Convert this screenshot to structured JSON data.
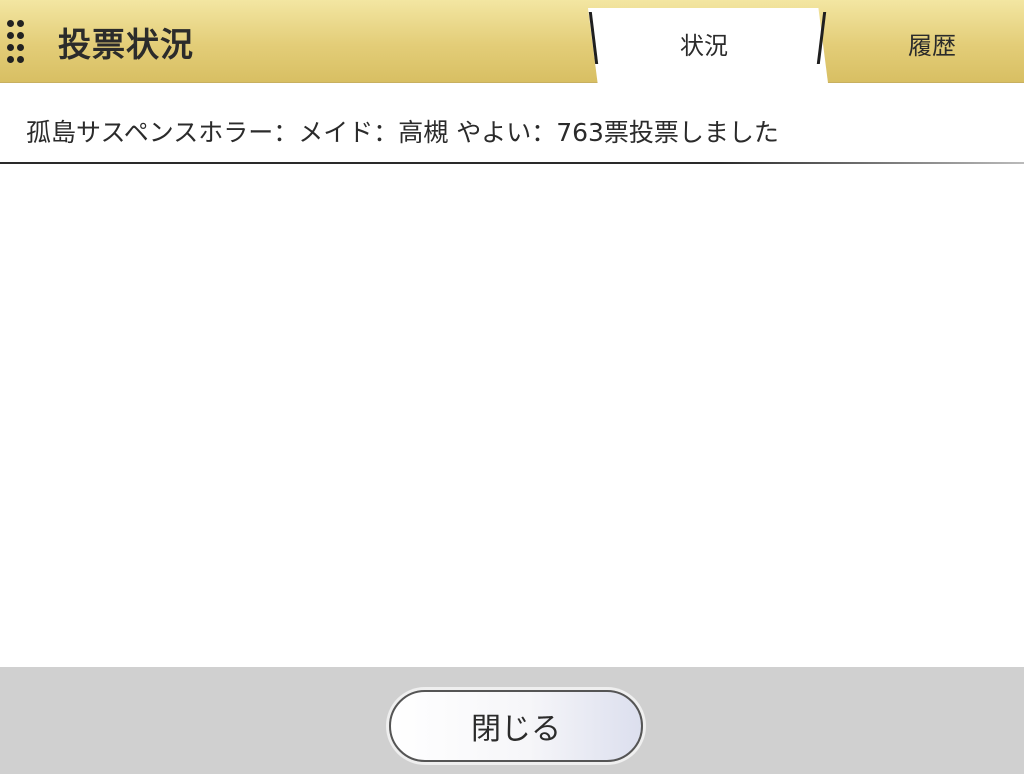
{
  "header": {
    "title": "投票状況",
    "tabs": [
      {
        "label": "状況",
        "active": true
      },
      {
        "label": "履歴",
        "active": false
      }
    ]
  },
  "status": {
    "message": "孤島サスペンスホラー：メイド：高槻 やよい：763票投票しました"
  },
  "footer": {
    "close_label": "閉じる"
  },
  "colors": {
    "header_gold": "#e3cd78",
    "footer_gray": "#d0d0d0",
    "text": "#2b2b2b"
  },
  "icons": {
    "menu": "grip-dots-icon"
  }
}
